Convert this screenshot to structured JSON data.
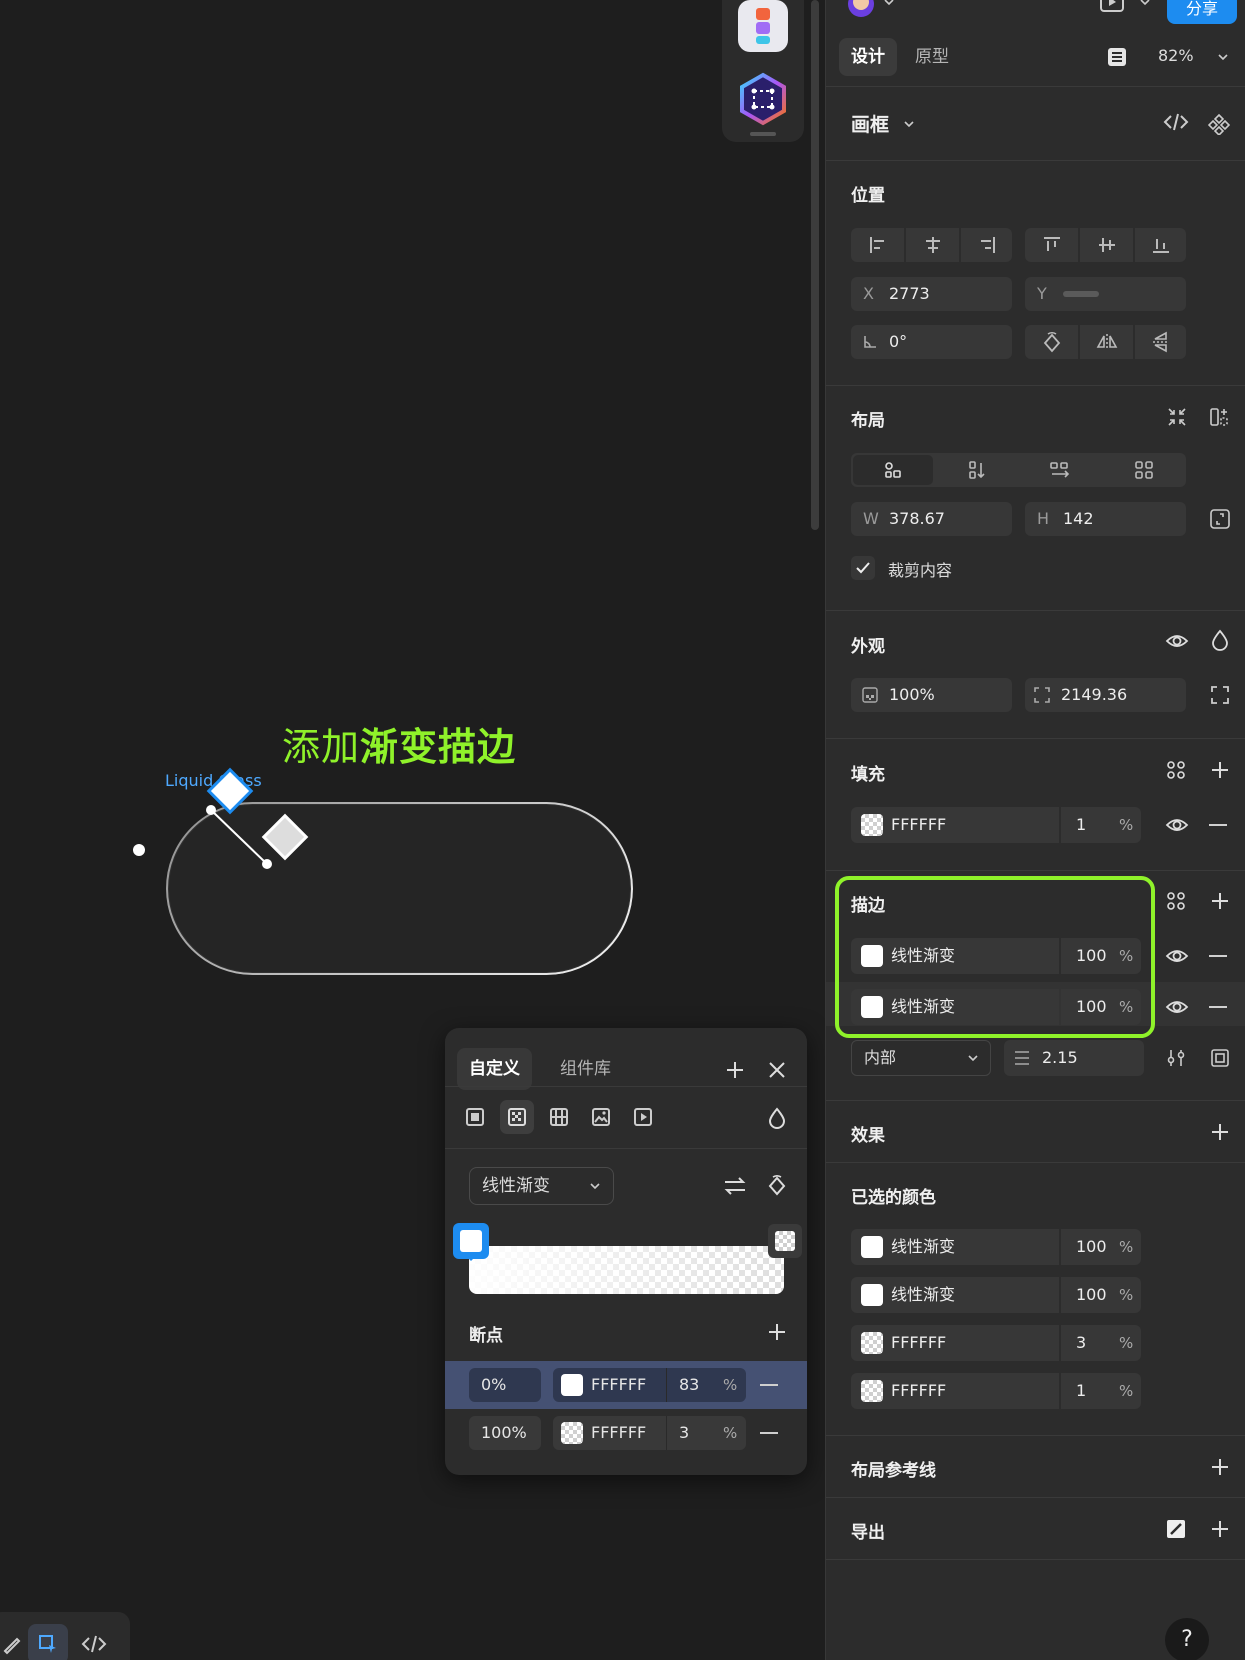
{
  "canvas": {
    "title_plain": "添加",
    "title_bold": "渐变描边",
    "frame_label": "Liquid Glass"
  },
  "picker": {
    "tabs": [
      "自定义",
      "组件库"
    ],
    "gradient_type": "线性渐变",
    "stops_title": "断点",
    "stops": [
      {
        "position": "0%",
        "hex": "FFFFFF",
        "opacity": "83",
        "unit": "%"
      },
      {
        "position": "100%",
        "hex": "FFFFFF",
        "opacity": "3",
        "unit": "%"
      }
    ]
  },
  "panel": {
    "share_label": "分享",
    "help_label": "?",
    "tabs": [
      "设计",
      "原型"
    ],
    "zoom": "82%",
    "frame_title": "画框",
    "position": {
      "title": "位置",
      "x_label": "X",
      "x_value": "2773",
      "y_label": "Y",
      "y_value": "",
      "rotation": "0°"
    },
    "layout": {
      "title": "布局",
      "w_label": "W",
      "w_value": "378.67",
      "h_label": "H",
      "h_value": "142",
      "clip_label": "裁剪内容"
    },
    "appearance": {
      "title": "外观",
      "opacity": "100%",
      "radius": "2149.36"
    },
    "fill": {
      "title": "填充",
      "items": [
        {
          "name": "FFFFFF",
          "opacity": "1",
          "unit": "%"
        }
      ]
    },
    "stroke": {
      "title": "描边",
      "items": [
        {
          "name": "线性渐变",
          "opacity": "100",
          "unit": "%"
        },
        {
          "name": "线性渐变",
          "opacity": "100",
          "unit": "%"
        }
      ],
      "position": "内部",
      "weight": "2.15"
    },
    "effects": {
      "title": "效果"
    },
    "selection_colors": {
      "title": "已选的颜色",
      "items": [
        {
          "name": "线性渐变",
          "opacity": "100",
          "unit": "%"
        },
        {
          "name": "线性渐变",
          "opacity": "100",
          "unit": "%"
        },
        {
          "name": "FFFFFF",
          "opacity": "3",
          "unit": "%"
        },
        {
          "name": "FFFFFF",
          "opacity": "1",
          "unit": "%"
        }
      ]
    },
    "layout_guides": {
      "title": "布局参考线"
    },
    "export": {
      "title": "导出"
    }
  },
  "colors": {
    "accent_blue": "#1d8cf0",
    "highlight_green": "#8ff22a",
    "panel_bg": "#2c2c2c",
    "canvas_bg": "#1e1e1e"
  },
  "icons": [
    "plus-icon",
    "close-icon",
    "eye-icon",
    "minus-icon",
    "drop-icon",
    "chevron-down-icon",
    "code-icon",
    "component-icon",
    "styles-icon",
    "swap-icon",
    "rotate-icon"
  ]
}
